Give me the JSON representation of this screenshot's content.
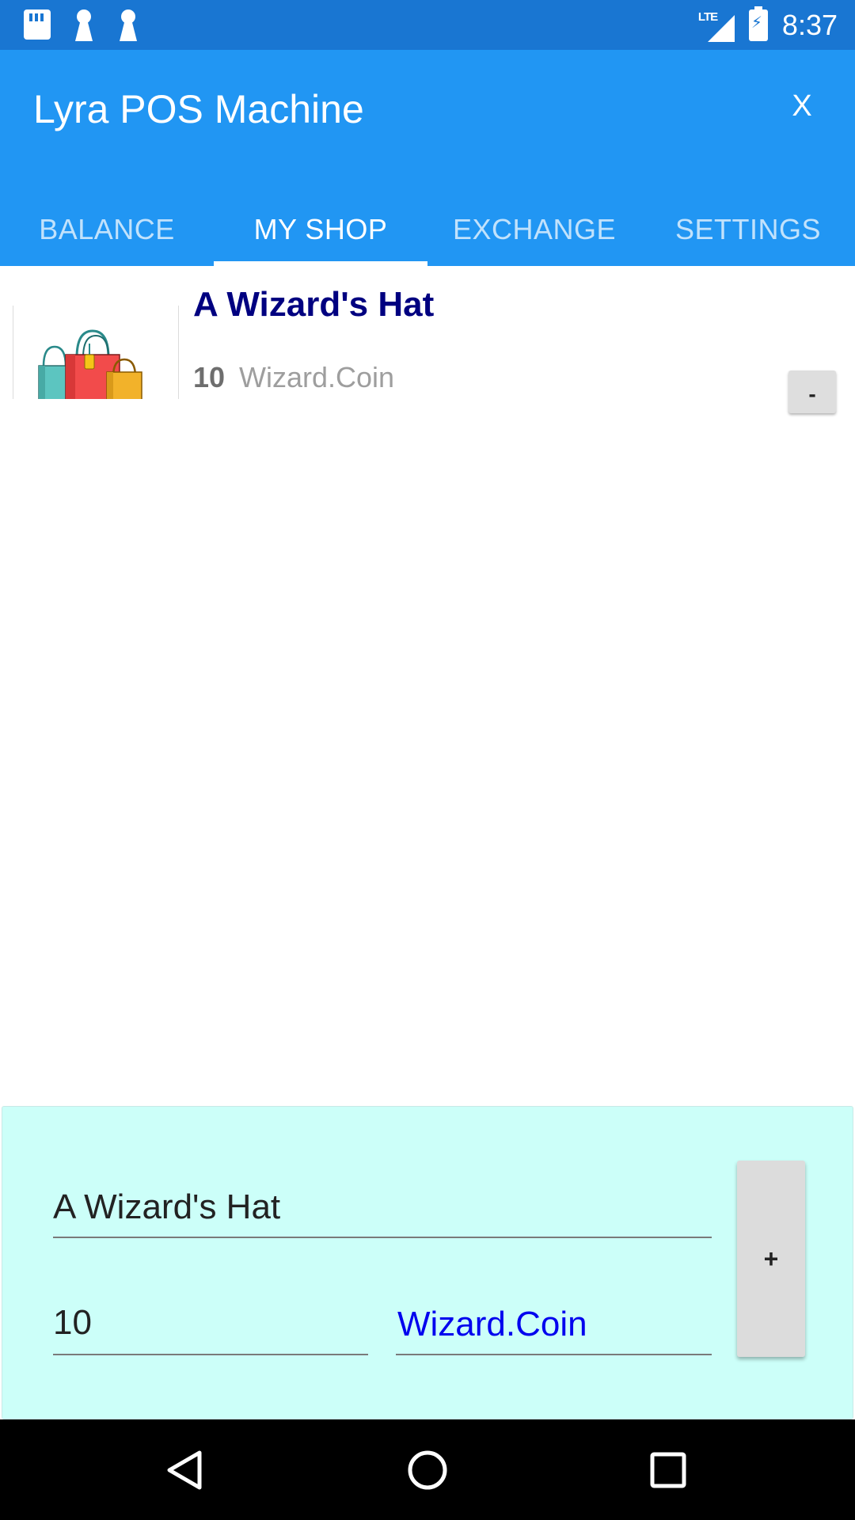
{
  "status_bar": {
    "time": "8:37",
    "network": "LTE",
    "icons": [
      "sd-card-icon",
      "key-icon",
      "key-icon",
      "lte-signal-icon",
      "battery-charging-icon"
    ]
  },
  "app_bar": {
    "title": "Lyra POS Machine",
    "close_label": "X"
  },
  "tabs": [
    {
      "label": "BALANCE",
      "active": false
    },
    {
      "label": "MY SHOP",
      "active": true
    },
    {
      "label": "EXCHANGE",
      "active": false
    },
    {
      "label": "SETTINGS",
      "active": false
    }
  ],
  "shop_items": [
    {
      "title": "A Wizard's Hat",
      "price": "10",
      "currency": "Wizard.Coin",
      "image": "shopping-bags-image",
      "remove_label": "-"
    }
  ],
  "add_form": {
    "name_value": "A Wizard's Hat",
    "price_value": "10",
    "currency_value": "Wizard.Coin",
    "add_label": "+"
  },
  "colors": {
    "status_bar": "#1976D2",
    "app_bar": "#2196F3",
    "item_title": "#000080",
    "currency_link": "#0000EE",
    "panel_background": "#CCFFF9"
  },
  "nav_bar": {
    "icons": [
      "back-icon",
      "home-icon",
      "recents-icon"
    ]
  }
}
